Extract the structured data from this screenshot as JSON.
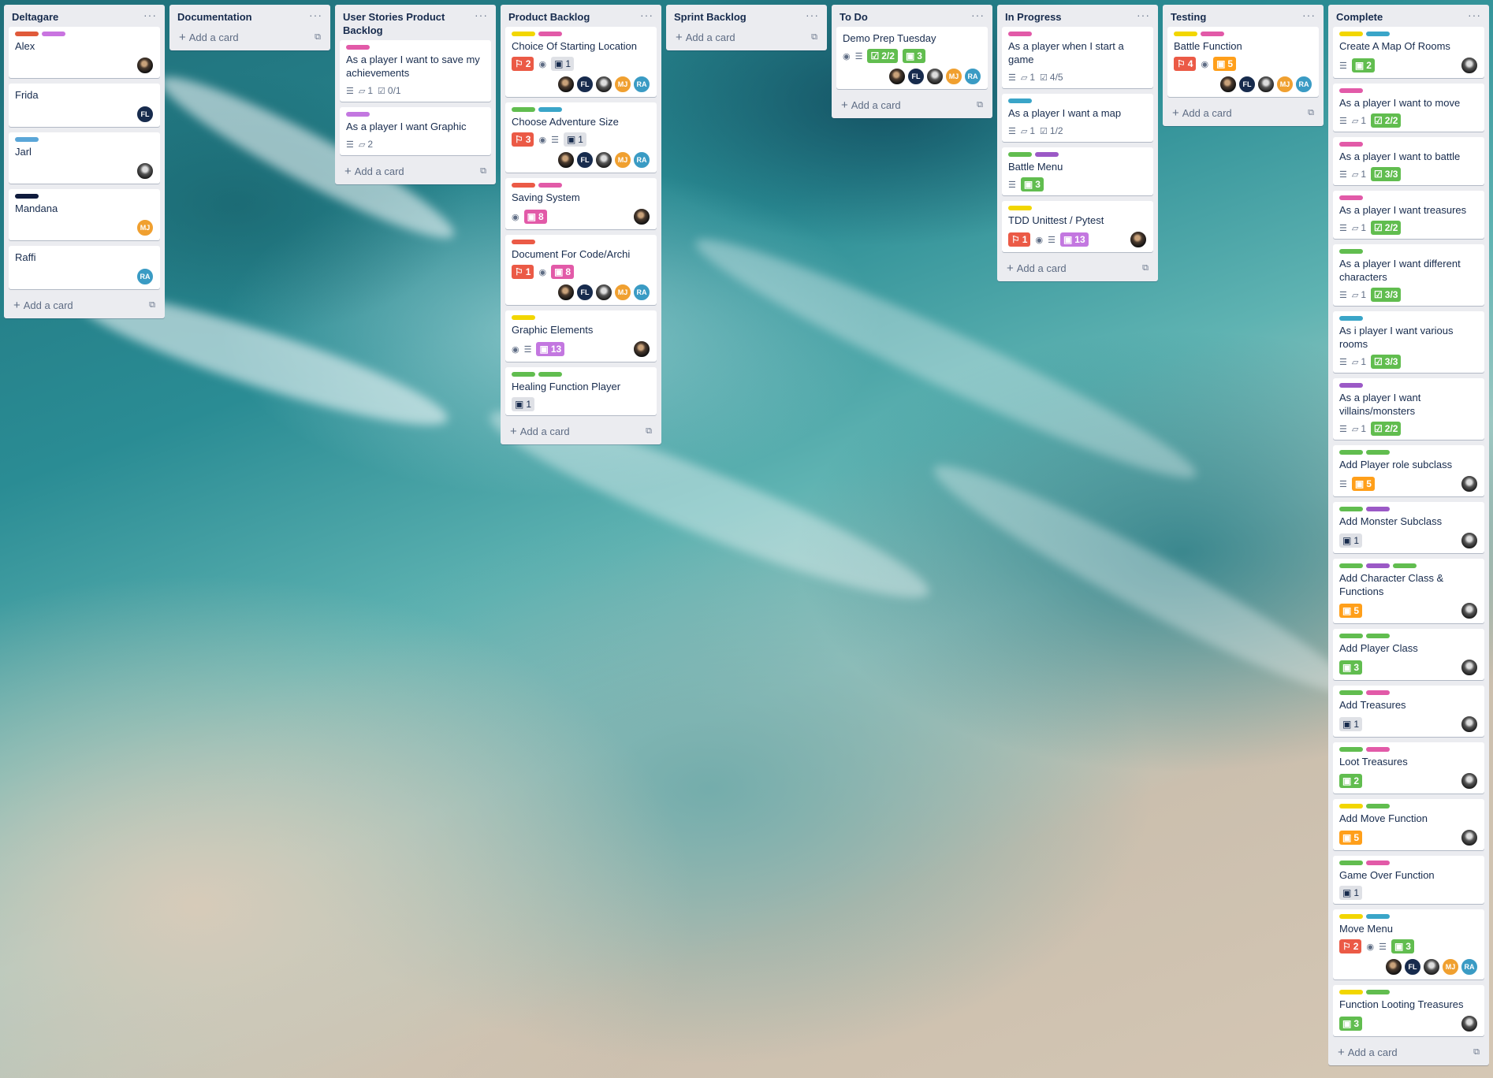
{
  "colors": {
    "red": "#eb5a46",
    "green": "#61bd4f",
    "pink": "#ff78cb",
    "purple": "#c377e0",
    "blue": "#0079bf",
    "sky": "#00c2e0",
    "yellow": "#f2d600",
    "navy": "#172b4d",
    "violet": "#a46fd0"
  },
  "add_card_label": "Add a card",
  "lists": [
    {
      "title": "Deltagare",
      "cards": [
        {
          "labels": [
            "#e05a3a",
            "#c974e0"
          ],
          "title": "Alex",
          "members": [
            {
              "type": "photo"
            }
          ]
        },
        {
          "labels": [],
          "title": "Frida",
          "members": [
            {
              "initials": "FL",
              "color": "#172b4d"
            }
          ]
        },
        {
          "labels": [
            "#5aa6d8"
          ],
          "title": "Jarl",
          "members": [
            {
              "type": "photo2"
            }
          ]
        },
        {
          "labels": [
            "#0f1b3d"
          ],
          "title": "Mandana",
          "members": [
            {
              "initials": "MJ",
              "color": "#f0a030"
            }
          ]
        },
        {
          "labels": [],
          "title": "Raffi",
          "members": [
            {
              "initials": "RA",
              "color": "#3a9bc4"
            }
          ]
        }
      ]
    },
    {
      "title": "Documentation",
      "cards": []
    },
    {
      "title": "User Stories Product Backlog",
      "cards": [
        {
          "labels": [
            "#e25aa8"
          ],
          "title": "As a player I want to save my achievements",
          "badges": [
            {
              "t": "desc"
            },
            {
              "t": "comment",
              "v": "1"
            },
            {
              "t": "check",
              "v": "0/1"
            }
          ]
        },
        {
          "labels": [
            "#c377e0"
          ],
          "title": "As a player I want Graphic",
          "badges": [
            {
              "t": "desc"
            },
            {
              "t": "comment",
              "v": "2"
            }
          ]
        }
      ]
    },
    {
      "title": "Product Backlog",
      "cards": [
        {
          "labels": [
            "#f2d600",
            "#e25aa8"
          ],
          "title": "Choice Of Starting Location",
          "badges": [
            {
              "t": "pill",
              "c": "#eb5a46",
              "i": "⚐",
              "v": "2"
            },
            {
              "t": "watch"
            },
            {
              "t": "pill",
              "c": "grey",
              "i": "▣",
              "v": "1"
            }
          ],
          "members": [
            {
              "type": "photo"
            },
            {
              "initials": "FL",
              "color": "#172b4d"
            },
            {
              "type": "photo2"
            },
            {
              "initials": "MJ",
              "color": "#f0a030"
            },
            {
              "initials": "RA",
              "color": "#3a9bc4"
            }
          ]
        },
        {
          "labels": [
            "#61bd4f",
            "#3aa5c8"
          ],
          "title": "Choose Adventure Size",
          "badges": [
            {
              "t": "pill",
              "c": "#eb5a46",
              "i": "⚐",
              "v": "3"
            },
            {
              "t": "watch"
            },
            {
              "t": "desc"
            },
            {
              "t": "pill",
              "c": "grey",
              "i": "▣",
              "v": "1"
            }
          ],
          "members": [
            {
              "type": "photo"
            },
            {
              "initials": "FL",
              "color": "#172b4d"
            },
            {
              "type": "photo2"
            },
            {
              "initials": "MJ",
              "color": "#f0a030"
            },
            {
              "initials": "RA",
              "color": "#3a9bc4"
            }
          ]
        },
        {
          "labels": [
            "#eb5a46",
            "#e25aa8"
          ],
          "title": "Saving System",
          "badges": [
            {
              "t": "watch"
            },
            {
              "t": "pill",
              "c": "#e25aa8",
              "i": "▣",
              "v": "8"
            }
          ],
          "members": [
            {
              "type": "photo"
            }
          ]
        },
        {
          "labels": [
            "#eb5a46"
          ],
          "title": "Document For Code/Archi",
          "badges": [
            {
              "t": "pill",
              "c": "#eb5a46",
              "i": "⚐",
              "v": "1"
            },
            {
              "t": "watch"
            },
            {
              "t": "pill",
              "c": "#e25aa8",
              "i": "▣",
              "v": "8"
            }
          ],
          "members": [
            {
              "type": "photo"
            },
            {
              "initials": "FL",
              "color": "#172b4d"
            },
            {
              "type": "photo2"
            },
            {
              "initials": "MJ",
              "color": "#f0a030"
            },
            {
              "initials": "RA",
              "color": "#3a9bc4"
            }
          ]
        },
        {
          "labels": [
            "#f2d600"
          ],
          "title": "Graphic Elements",
          "badges": [
            {
              "t": "watch"
            },
            {
              "t": "desc"
            },
            {
              "t": "pill",
              "c": "#c377e0",
              "i": "▣",
              "v": "13"
            }
          ],
          "members": [
            {
              "type": "photo"
            }
          ]
        },
        {
          "labels": [
            "#61bd4f",
            "#61bd4f"
          ],
          "title": "Healing Function Player",
          "badges": [
            {
              "t": "pill",
              "c": "grey",
              "i": "▣",
              "v": "1"
            }
          ]
        }
      ]
    },
    {
      "title": "Sprint Backlog",
      "cards": []
    },
    {
      "title": "To Do",
      "cards": [
        {
          "labels": [],
          "title": "Demo Prep Tuesday",
          "badges": [
            {
              "t": "watch"
            },
            {
              "t": "desc"
            },
            {
              "t": "pill",
              "c": "#61bd4f",
              "i": "☑",
              "v": "2/2"
            },
            {
              "t": "pill",
              "c": "#61bd4f",
              "i": "▣",
              "v": "3"
            }
          ],
          "members": [
            {
              "type": "photo"
            },
            {
              "initials": "FL",
              "color": "#172b4d"
            },
            {
              "type": "photo2"
            },
            {
              "initials": "MJ",
              "color": "#f0a030"
            },
            {
              "initials": "RA",
              "color": "#3a9bc4"
            }
          ]
        }
      ]
    },
    {
      "title": "In Progress",
      "cards": [
        {
          "labels": [
            "#e25aa8"
          ],
          "title": "As a player when I start a game",
          "badges": [
            {
              "t": "desc"
            },
            {
              "t": "comment",
              "v": "1"
            },
            {
              "t": "check",
              "v": "4/5"
            }
          ]
        },
        {
          "labels": [
            "#3aa5c8"
          ],
          "title": "As a player I want a map",
          "badges": [
            {
              "t": "desc"
            },
            {
              "t": "comment",
              "v": "1"
            },
            {
              "t": "check",
              "v": "1/2"
            }
          ]
        },
        {
          "labels": [
            "#61bd4f",
            "#9b59c6"
          ],
          "title": "Battle Menu",
          "badges": [
            {
              "t": "desc"
            },
            {
              "t": "pill",
              "c": "#61bd4f",
              "i": "▣",
              "v": "3"
            }
          ]
        },
        {
          "labels": [
            "#f2d600"
          ],
          "title": "TDD Unittest / Pytest",
          "badges": [
            {
              "t": "pill",
              "c": "#eb5a46",
              "i": "⚐",
              "v": "1"
            },
            {
              "t": "watch"
            },
            {
              "t": "desc"
            },
            {
              "t": "pill",
              "c": "#c377e0",
              "i": "▣",
              "v": "13"
            }
          ],
          "members": [
            {
              "type": "photo"
            }
          ]
        }
      ]
    },
    {
      "title": "Testing",
      "cards": [
        {
          "labels": [
            "#f2d600",
            "#e25aa8"
          ],
          "title": "Battle Function",
          "badges": [
            {
              "t": "pill",
              "c": "#eb5a46",
              "i": "⚐",
              "v": "4"
            },
            {
              "t": "watch"
            },
            {
              "t": "pill",
              "c": "#ff9f1a",
              "i": "▣",
              "v": "5"
            }
          ],
          "members": [
            {
              "type": "photo"
            },
            {
              "initials": "FL",
              "color": "#172b4d"
            },
            {
              "type": "photo2"
            },
            {
              "initials": "MJ",
              "color": "#f0a030"
            },
            {
              "initials": "RA",
              "color": "#3a9bc4"
            }
          ]
        }
      ]
    },
    {
      "title": "Complete",
      "cards": [
        {
          "labels": [
            "#f2d600",
            "#3aa5c8"
          ],
          "title": "Create A Map Of Rooms",
          "badges": [
            {
              "t": "desc"
            },
            {
              "t": "pill",
              "c": "#61bd4f",
              "i": "▣",
              "v": "2"
            }
          ],
          "members": [
            {
              "type": "photo2"
            }
          ]
        },
        {
          "labels": [
            "#e25aa8"
          ],
          "title": "As a player I want to move",
          "badges": [
            {
              "t": "desc"
            },
            {
              "t": "comment",
              "v": "1"
            },
            {
              "t": "pill",
              "c": "#61bd4f",
              "i": "☑",
              "v": "2/2"
            }
          ]
        },
        {
          "labels": [
            "#e25aa8"
          ],
          "title": "As a player I want to battle",
          "badges": [
            {
              "t": "desc"
            },
            {
              "t": "comment",
              "v": "1"
            },
            {
              "t": "pill",
              "c": "#61bd4f",
              "i": "☑",
              "v": "3/3"
            }
          ]
        },
        {
          "labels": [
            "#e25aa8"
          ],
          "title": "As a player I want treasures",
          "badges": [
            {
              "t": "desc"
            },
            {
              "t": "comment",
              "v": "1"
            },
            {
              "t": "pill",
              "c": "#61bd4f",
              "i": "☑",
              "v": "2/2"
            }
          ]
        },
        {
          "labels": [
            "#61bd4f"
          ],
          "title": "As a player I want different characters",
          "badges": [
            {
              "t": "desc"
            },
            {
              "t": "comment",
              "v": "1"
            },
            {
              "t": "pill",
              "c": "#61bd4f",
              "i": "☑",
              "v": "3/3"
            }
          ]
        },
        {
          "labels": [
            "#3aa5c8"
          ],
          "title": "As i player I want various rooms",
          "badges": [
            {
              "t": "desc"
            },
            {
              "t": "comment",
              "v": "1"
            },
            {
              "t": "pill",
              "c": "#61bd4f",
              "i": "☑",
              "v": "3/3"
            }
          ]
        },
        {
          "labels": [
            "#9b59c6"
          ],
          "title": "As a player I want villains/monsters",
          "badges": [
            {
              "t": "desc"
            },
            {
              "t": "comment",
              "v": "1"
            },
            {
              "t": "pill",
              "c": "#61bd4f",
              "i": "☑",
              "v": "2/2"
            }
          ]
        },
        {
          "labels": [
            "#61bd4f",
            "#61bd4f"
          ],
          "title": "Add Player role subclass",
          "badges": [
            {
              "t": "desc"
            },
            {
              "t": "pill",
              "c": "#ff9f1a",
              "i": "▣",
              "v": "5"
            }
          ],
          "members": [
            {
              "type": "photo2"
            }
          ]
        },
        {
          "labels": [
            "#61bd4f",
            "#9b59c6"
          ],
          "title": "Add Monster Subclass",
          "badges": [
            {
              "t": "pill",
              "c": "grey",
              "i": "▣",
              "v": "1"
            }
          ],
          "members": [
            {
              "type": "photo2"
            }
          ]
        },
        {
          "labels": [
            "#61bd4f",
            "#9b59c6",
            "#61bd4f"
          ],
          "title": "Add Character Class & Functions",
          "badges": [
            {
              "t": "pill",
              "c": "#ff9f1a",
              "i": "▣",
              "v": "5"
            }
          ],
          "members": [
            {
              "type": "photo2"
            }
          ]
        },
        {
          "labels": [
            "#61bd4f",
            "#61bd4f"
          ],
          "title": "Add Player Class",
          "badges": [
            {
              "t": "pill",
              "c": "#61bd4f",
              "i": "▣",
              "v": "3"
            }
          ],
          "members": [
            {
              "type": "photo2"
            }
          ]
        },
        {
          "labels": [
            "#61bd4f",
            "#e25aa8"
          ],
          "title": "Add Treasures",
          "badges": [
            {
              "t": "pill",
              "c": "grey",
              "i": "▣",
              "v": "1"
            }
          ],
          "members": [
            {
              "type": "photo2"
            }
          ]
        },
        {
          "labels": [
            "#61bd4f",
            "#e25aa8"
          ],
          "title": "Loot Treasures",
          "badges": [
            {
              "t": "pill",
              "c": "#61bd4f",
              "i": "▣",
              "v": "2"
            }
          ],
          "members": [
            {
              "type": "photo2"
            }
          ]
        },
        {
          "labels": [
            "#f2d600",
            "#61bd4f"
          ],
          "title": "Add Move Function",
          "badges": [
            {
              "t": "pill",
              "c": "#ff9f1a",
              "i": "▣",
              "v": "5"
            }
          ],
          "members": [
            {
              "type": "photo2"
            }
          ]
        },
        {
          "labels": [
            "#61bd4f",
            "#e25aa8"
          ],
          "title": "Game Over Function",
          "badges": [
            {
              "t": "pill",
              "c": "grey",
              "i": "▣",
              "v": "1"
            }
          ]
        },
        {
          "labels": [
            "#f2d600",
            "#3aa5c8"
          ],
          "title": "Move Menu",
          "badges": [
            {
              "t": "pill",
              "c": "#eb5a46",
              "i": "⚐",
              "v": "2"
            },
            {
              "t": "watch"
            },
            {
              "t": "desc"
            },
            {
              "t": "pill",
              "c": "#61bd4f",
              "i": "▣",
              "v": "3"
            }
          ],
          "members": [
            {
              "type": "photo"
            },
            {
              "initials": "FL",
              "color": "#172b4d"
            },
            {
              "type": "photo2"
            },
            {
              "initials": "MJ",
              "color": "#f0a030"
            },
            {
              "initials": "RA",
              "color": "#3a9bc4"
            }
          ]
        },
        {
          "labels": [
            "#f2d600",
            "#61bd4f"
          ],
          "title": "Function Looting Treasures",
          "badges": [
            {
              "t": "pill",
              "c": "#61bd4f",
              "i": "▣",
              "v": "3"
            }
          ],
          "members": [
            {
              "type": "photo2"
            }
          ]
        }
      ]
    }
  ]
}
